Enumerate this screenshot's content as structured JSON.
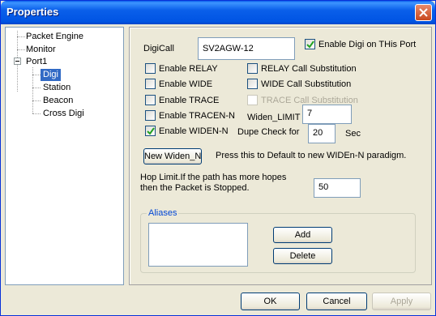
{
  "window": {
    "title": "Properties"
  },
  "tree": {
    "items": [
      {
        "label": "Packet Engine"
      },
      {
        "label": "Monitor"
      },
      {
        "label": "Port1"
      },
      {
        "label": "Digi"
      },
      {
        "label": "Station"
      },
      {
        "label": "Beacon"
      },
      {
        "label": "Cross Digi"
      }
    ]
  },
  "digi": {
    "digicall_label": "DigiCall",
    "digicall_value": "SV2AGW-12",
    "enable_digi": {
      "label": "Enable Digi on THis Port",
      "checked": true
    },
    "checkboxes": [
      {
        "label": "Enable RELAY",
        "checked": false,
        "enabled": true
      },
      {
        "label": "Enable WIDE",
        "checked": false,
        "enabled": true
      },
      {
        "label": "Enable TRACE",
        "checked": false,
        "enabled": true
      },
      {
        "label": "Enable TRACEN-N",
        "checked": false,
        "enabled": true
      },
      {
        "label": "Enable WIDEN-N",
        "checked": true,
        "enabled": true
      },
      {
        "label": "RELAY Call Substitution",
        "checked": false,
        "enabled": true
      },
      {
        "label": "WIDE Call Substitution",
        "checked": false,
        "enabled": true
      },
      {
        "label": "TRACE Call Substitution",
        "checked": false,
        "enabled": false
      }
    ],
    "widen_limit_label": "Widen_LIMIT",
    "widen_limit_value": "7",
    "dupe_check_label": "Dupe Check for",
    "dupe_check_value": "20",
    "dupe_check_unit": "Sec",
    "new_widen_button": "New Widen_N",
    "new_widen_hint": "Press this to Default to new WIDEn-N paradigm.",
    "hop_limit_line1": "Hop Limit.If the path has more hopes",
    "hop_limit_line2": "then the Packet is Stopped.",
    "hop_limit_value": "50",
    "aliases_legend": "Aliases",
    "add_button": "Add",
    "delete_button": "Delete"
  },
  "footer": {
    "ok": "OK",
    "cancel": "Cancel",
    "apply": "Apply"
  },
  "colors": {
    "titlebar": "#0054e3",
    "selection": "#316ac5",
    "window_bg": "#ece9d8"
  }
}
